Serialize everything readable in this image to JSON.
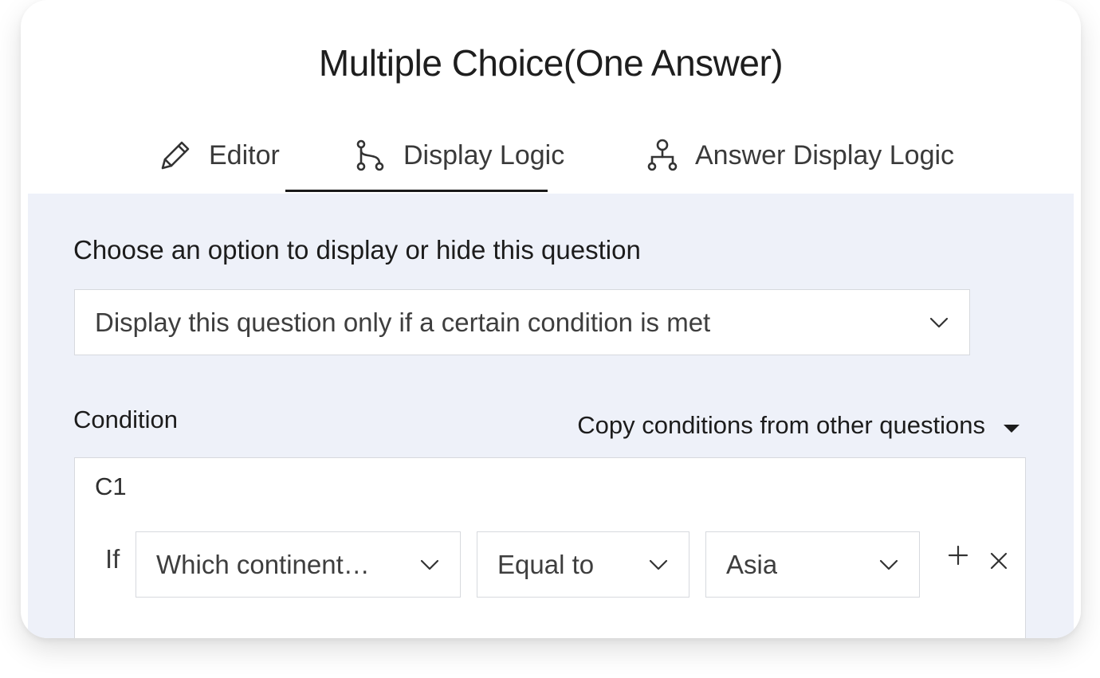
{
  "title": "Multiple Choice(One Answer)",
  "tabs": [
    {
      "label": "Editor",
      "icon": "pencil-icon",
      "active": false
    },
    {
      "label": "Display Logic",
      "icon": "branch-icon",
      "active": true
    },
    {
      "label": "Answer Display Logic",
      "icon": "hierarchy-icon",
      "active": false
    }
  ],
  "display_logic": {
    "prompt": "Choose an option to display or hide this question",
    "mode_select": {
      "value": "Display this question only if a certain condition is met"
    },
    "condition_label": "Condition",
    "copy_conditions_label": "Copy conditions from other questions",
    "conditions": [
      {
        "id": "C1",
        "if_label": "If",
        "question": "Which continent…",
        "operator": "Equal to",
        "value": "Asia"
      }
    ]
  },
  "colors": {
    "panel_background": "#eef1f9",
    "active_tab_underline": "#1b1b1b",
    "border": "#d7d9de"
  }
}
